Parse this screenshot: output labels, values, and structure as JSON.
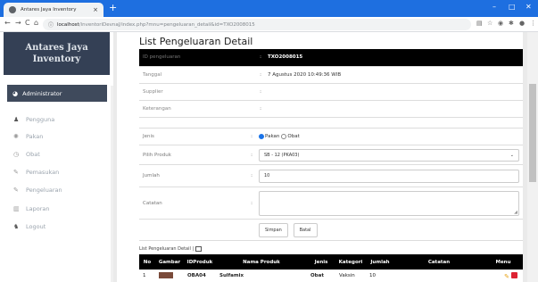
{
  "browser": {
    "tab_title": "Antares Jaya Inventory",
    "url_host": "localhost",
    "url_path": "/inventoriDevnaJ/index.php?mnu=pengeluaran_detail&id=TXO2008015",
    "new_tab": "+",
    "minimize": "–",
    "maximize": "□",
    "close": "✕"
  },
  "sidebar": {
    "brand_line1": "Antares Jaya",
    "brand_line2": "Inventory",
    "admin_label": "Administrator",
    "items": [
      {
        "label": "Pengguna",
        "icon": "user-icon"
      },
      {
        "label": "Pakan",
        "icon": "gear-icon"
      },
      {
        "label": "Obat",
        "icon": "clock-icon"
      },
      {
        "label": "Pemasukan",
        "icon": "pencil-icon"
      },
      {
        "label": "Pengeluaran",
        "icon": "pencil-icon"
      },
      {
        "label": "Laporan",
        "icon": "report-icon"
      },
      {
        "label": "Logout",
        "icon": "group-icon"
      }
    ]
  },
  "page": {
    "title": "List Pengeluaran Detail",
    "info": {
      "id_label": "ID pengeluaran",
      "id_value": "TXO2008015",
      "tanggal_label": "Tanggal",
      "tanggal_value": "7 Agustus 2020 10:49:36 WIB",
      "supplier_label": "Supplier",
      "supplier_value": "",
      "keterangan_label": "Keterangan",
      "keterangan_value": ""
    },
    "form": {
      "jenis_label": "Jenis",
      "opt_pakan": "Pakan",
      "opt_obat": "Obat",
      "produk_label": "Pilih Produk",
      "produk_value": "SB - 12 (PKA03)",
      "jumlah_label": "Jumlah",
      "jumlah_value": "10",
      "catatan_label": "Catatan",
      "catatan_value": "",
      "save_button": "Simpan",
      "cancel_button": "Batal"
    },
    "list_caption": "List Pengeluaran Detail |",
    "table": {
      "headers": [
        "No",
        "Gambar",
        "IDProduk",
        "Nama Produk",
        "Jenis",
        "Kategori",
        "Jumlah",
        "Catatan",
        "Menu"
      ],
      "rows": [
        {
          "no": "1",
          "id": "OBA04",
          "nama": "Sulfamix",
          "jenis": "Obat",
          "kategori": "Vaksin",
          "jumlah": "10",
          "catatan": ""
        }
      ]
    }
  },
  "colors": {
    "chrome_blue": "#1e6fe0",
    "sidebar_brand": "#344055",
    "admin_bar": "#3f4a5c",
    "table_header": "#000000"
  }
}
